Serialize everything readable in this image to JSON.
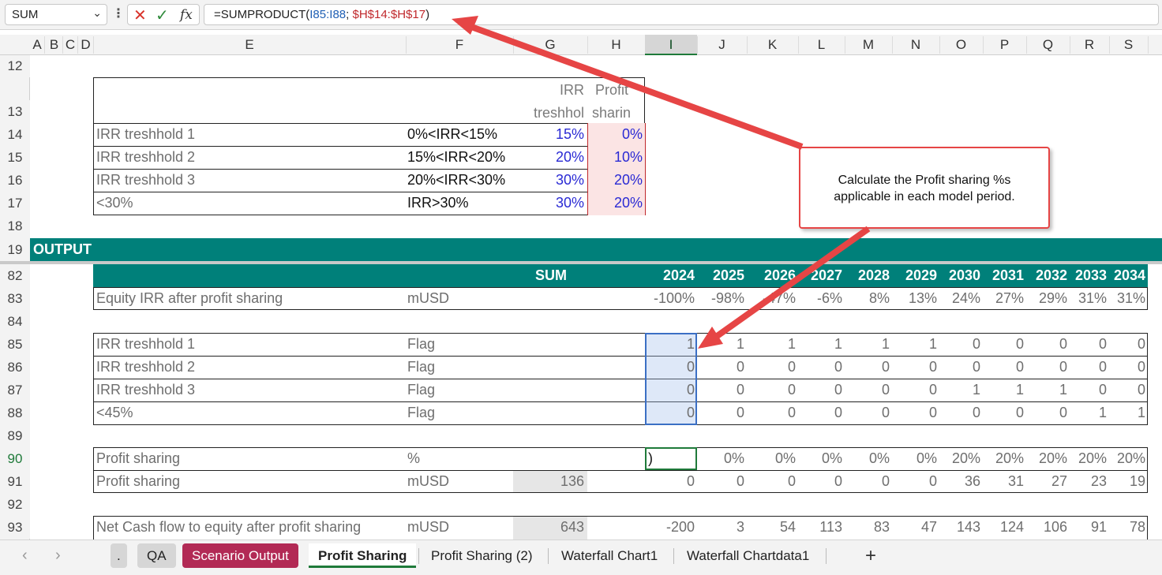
{
  "formula_bar": {
    "name_box": "SUM",
    "cancel_icon": "close-icon",
    "enter_icon": "check-icon",
    "fx_label": "fx",
    "formula_prefix": "=SUMPRODUCT(",
    "formula_ref1": "I85:I88",
    "formula_sep": "; ",
    "formula_ref2": "$H$14:$H$17",
    "formula_suffix": ")"
  },
  "columns": [
    "A",
    "B",
    "C",
    "D",
    "E",
    "F",
    "G",
    "H",
    "I",
    "J",
    "K",
    "L",
    "M",
    "N",
    "O",
    "P",
    "Q",
    "R",
    "S"
  ],
  "rows": [
    "12",
    "13",
    "14",
    "15",
    "16",
    "17",
    "18",
    "19",
    "82",
    "83",
    "84",
    "85",
    "86",
    "87",
    "88",
    "89",
    "90",
    "91",
    "92",
    "93"
  ],
  "threshold_table": {
    "header_g_line1": "IRR",
    "header_g_line2": "treshhol",
    "header_h_line1": "Profit",
    "header_h_line2": "sharin",
    "rows": [
      {
        "label": "IRR treshhold 1",
        "cond": "0%<IRR<15%",
        "irr": "15%",
        "share": "0%"
      },
      {
        "label": "IRR treshhold 2",
        "cond": "15%<IRR<20%",
        "irr": "20%",
        "share": "10%"
      },
      {
        "label": "IRR treshhold 3",
        "cond": "20%<IRR<30%",
        "irr": "30%",
        "share": "20%"
      },
      {
        "label": "<30%",
        "cond": "IRR>30%",
        "irr": "30%",
        "share": "20%"
      }
    ]
  },
  "output_label": "OUTPUT",
  "output_header": {
    "sum": "SUM",
    "years": [
      "2024",
      "2025",
      "2026",
      "2027",
      "2028",
      "2029",
      "2030",
      "2031",
      "2032",
      "2033",
      "2034"
    ]
  },
  "equity_irr": {
    "label": "Equity IRR after profit sharing",
    "unit": "mUSD",
    "values": [
      "-100%",
      "-98%",
      "-47%",
      "-6%",
      "8%",
      "13%",
      "24%",
      "27%",
      "29%",
      "31%",
      "31%"
    ]
  },
  "flags": [
    {
      "label": "IRR treshhold 1",
      "unit": "Flag",
      "values": [
        "1",
        "1",
        "1",
        "1",
        "1",
        "1",
        "0",
        "0",
        "0",
        "0",
        "0"
      ]
    },
    {
      "label": "IRR treshhold 2",
      "unit": "Flag",
      "values": [
        "0",
        "0",
        "0",
        "0",
        "0",
        "0",
        "0",
        "0",
        "0",
        "0",
        "0"
      ]
    },
    {
      "label": "IRR treshhold 3",
      "unit": "Flag",
      "values": [
        "0",
        "0",
        "0",
        "0",
        "0",
        "0",
        "1",
        "1",
        "1",
        "0",
        "0"
      ]
    },
    {
      "label": "<45%",
      "unit": "Flag",
      "values": [
        "0",
        "0",
        "0",
        "0",
        "0",
        "0",
        "0",
        "0",
        "0",
        "1",
        "1"
      ]
    }
  ],
  "profit_sharing_pct": {
    "label": "Profit sharing",
    "unit": "%",
    "edit_value": ")",
    "values": [
      "0%",
      "0%",
      "0%",
      "0%",
      "0%",
      "20%",
      "20%",
      "20%",
      "20%",
      "20%"
    ]
  },
  "profit_sharing_musd": {
    "label": "Profit sharing",
    "unit": "mUSD",
    "sum": "136",
    "values": [
      "0",
      "0",
      "0",
      "0",
      "0",
      "0",
      "36",
      "31",
      "27",
      "23",
      "19"
    ]
  },
  "net_cash_flow": {
    "label": "Net Cash flow to equity after profit sharing",
    "unit": "mUSD",
    "sum": "643",
    "values": [
      "-200",
      "3",
      "54",
      "113",
      "83",
      "47",
      "143",
      "124",
      "106",
      "91",
      "78"
    ]
  },
  "callout": {
    "line1": "Calculate the Profit sharing %s",
    "line2": "applicable in each model period."
  },
  "tabs": {
    "prev_icon": "chevron-left-icon",
    "next_icon": "chevron-right-icon",
    "items": [
      ".",
      "QA",
      "Scenario Output",
      "Profit Sharing",
      "Profit Sharing (2)",
      "Waterfall Chart1",
      "Waterfall Chartdata1"
    ],
    "add_label": "+"
  },
  "colors": {
    "teal": "#00807a",
    "scenario_tab": "#b22a55",
    "accent_green": "#1f7a3a",
    "arrow_red": "#e64545"
  }
}
